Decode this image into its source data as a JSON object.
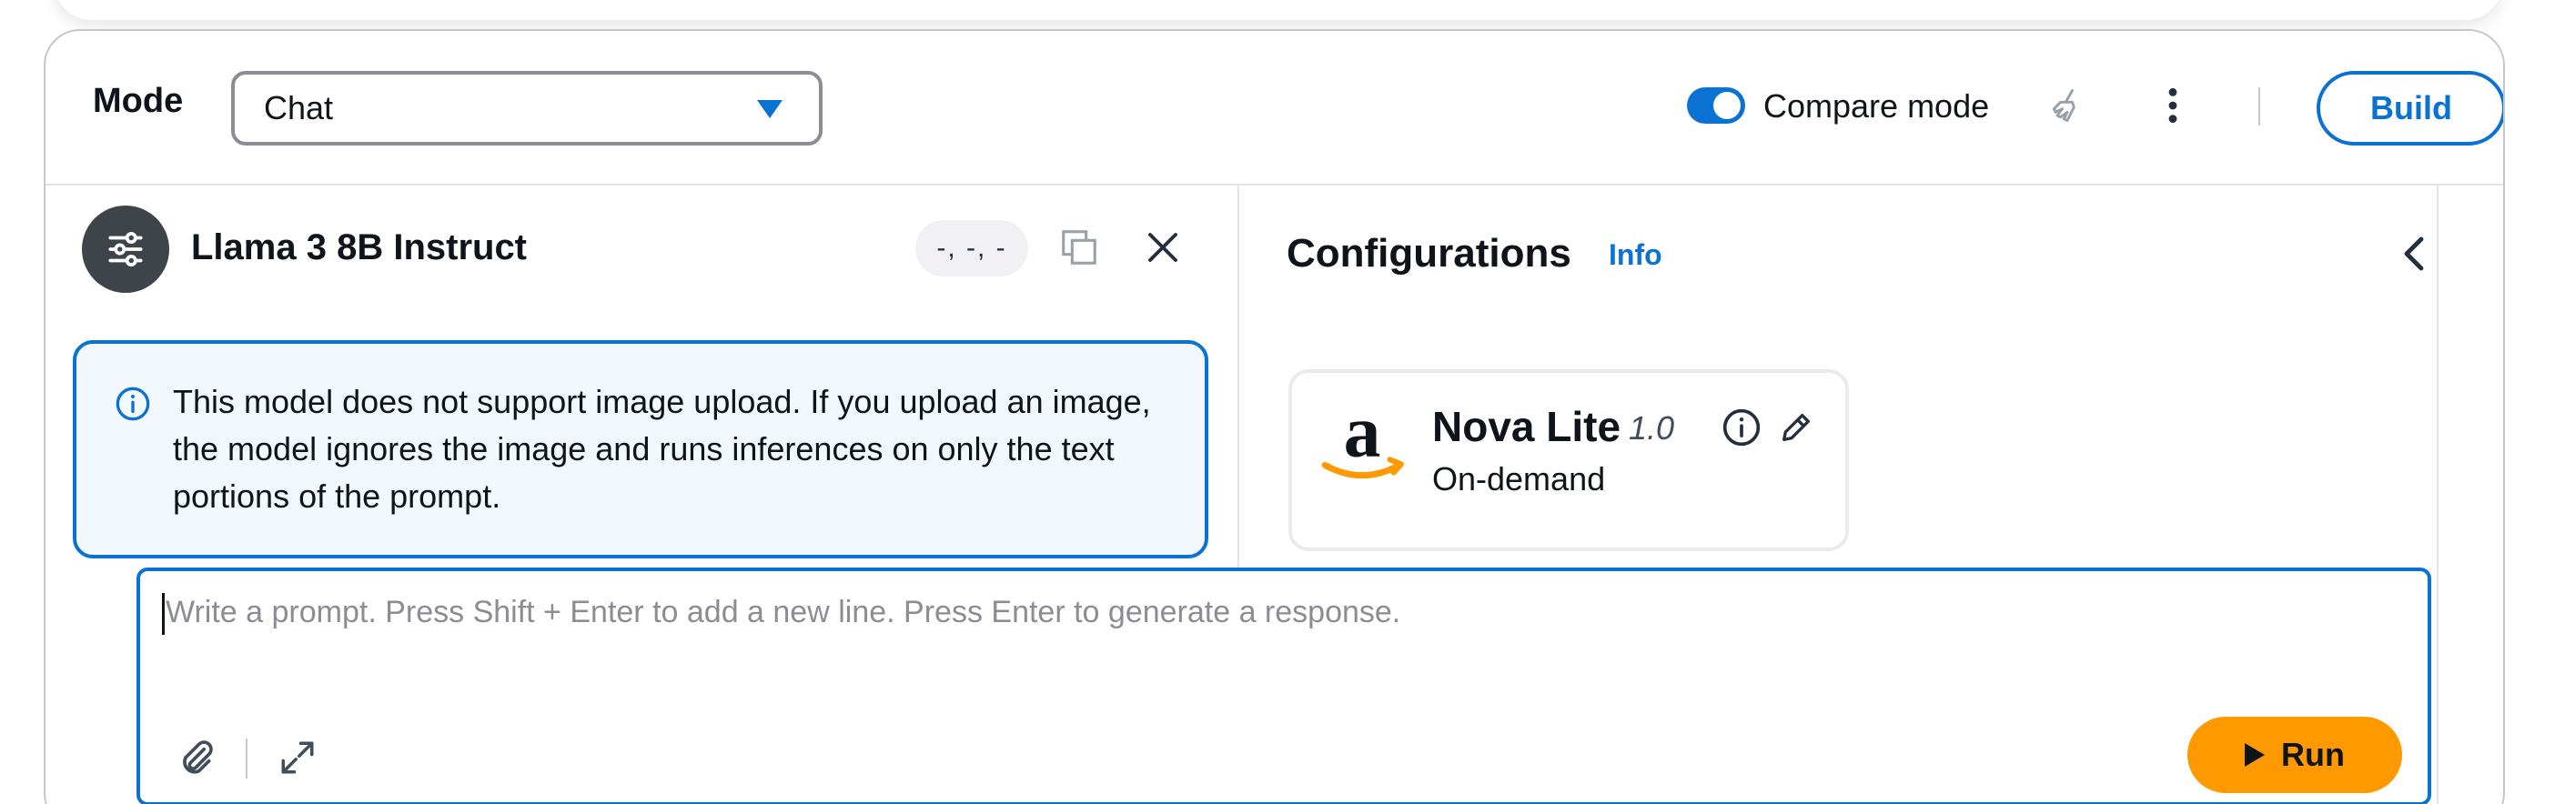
{
  "header": {
    "mode_label": "Mode",
    "mode_value": "Chat",
    "compare_mode_label": "Compare mode",
    "compare_mode_on": true,
    "build_label": "Build",
    "icons": [
      "clear-icon",
      "more-options-icon",
      "chevron-down-icon"
    ]
  },
  "model_panel": {
    "title": "Llama 3 8B Instruct",
    "loading_text": "-, -, -",
    "alert_text": "This model does not support image upload. If you upload an image, the model ignores the image and runs inferences on only the text portions of the prompt."
  },
  "configurations": {
    "title": "Configurations",
    "info_link": "Info",
    "model_card": {
      "name": "Nova Lite",
      "version": "1.0",
      "throughput": "On-demand",
      "logo": "amazon-logo"
    }
  },
  "prompt": {
    "placeholder": "Write a prompt. Press Shift + Enter to add a new line. Press Enter to generate a response.",
    "run_label": "Run"
  },
  "colors": {
    "accent": "#0972d3",
    "run_button": "#ff9900",
    "avatar_bg": "#3f434a",
    "alert_bg": "#f2f8fd"
  }
}
